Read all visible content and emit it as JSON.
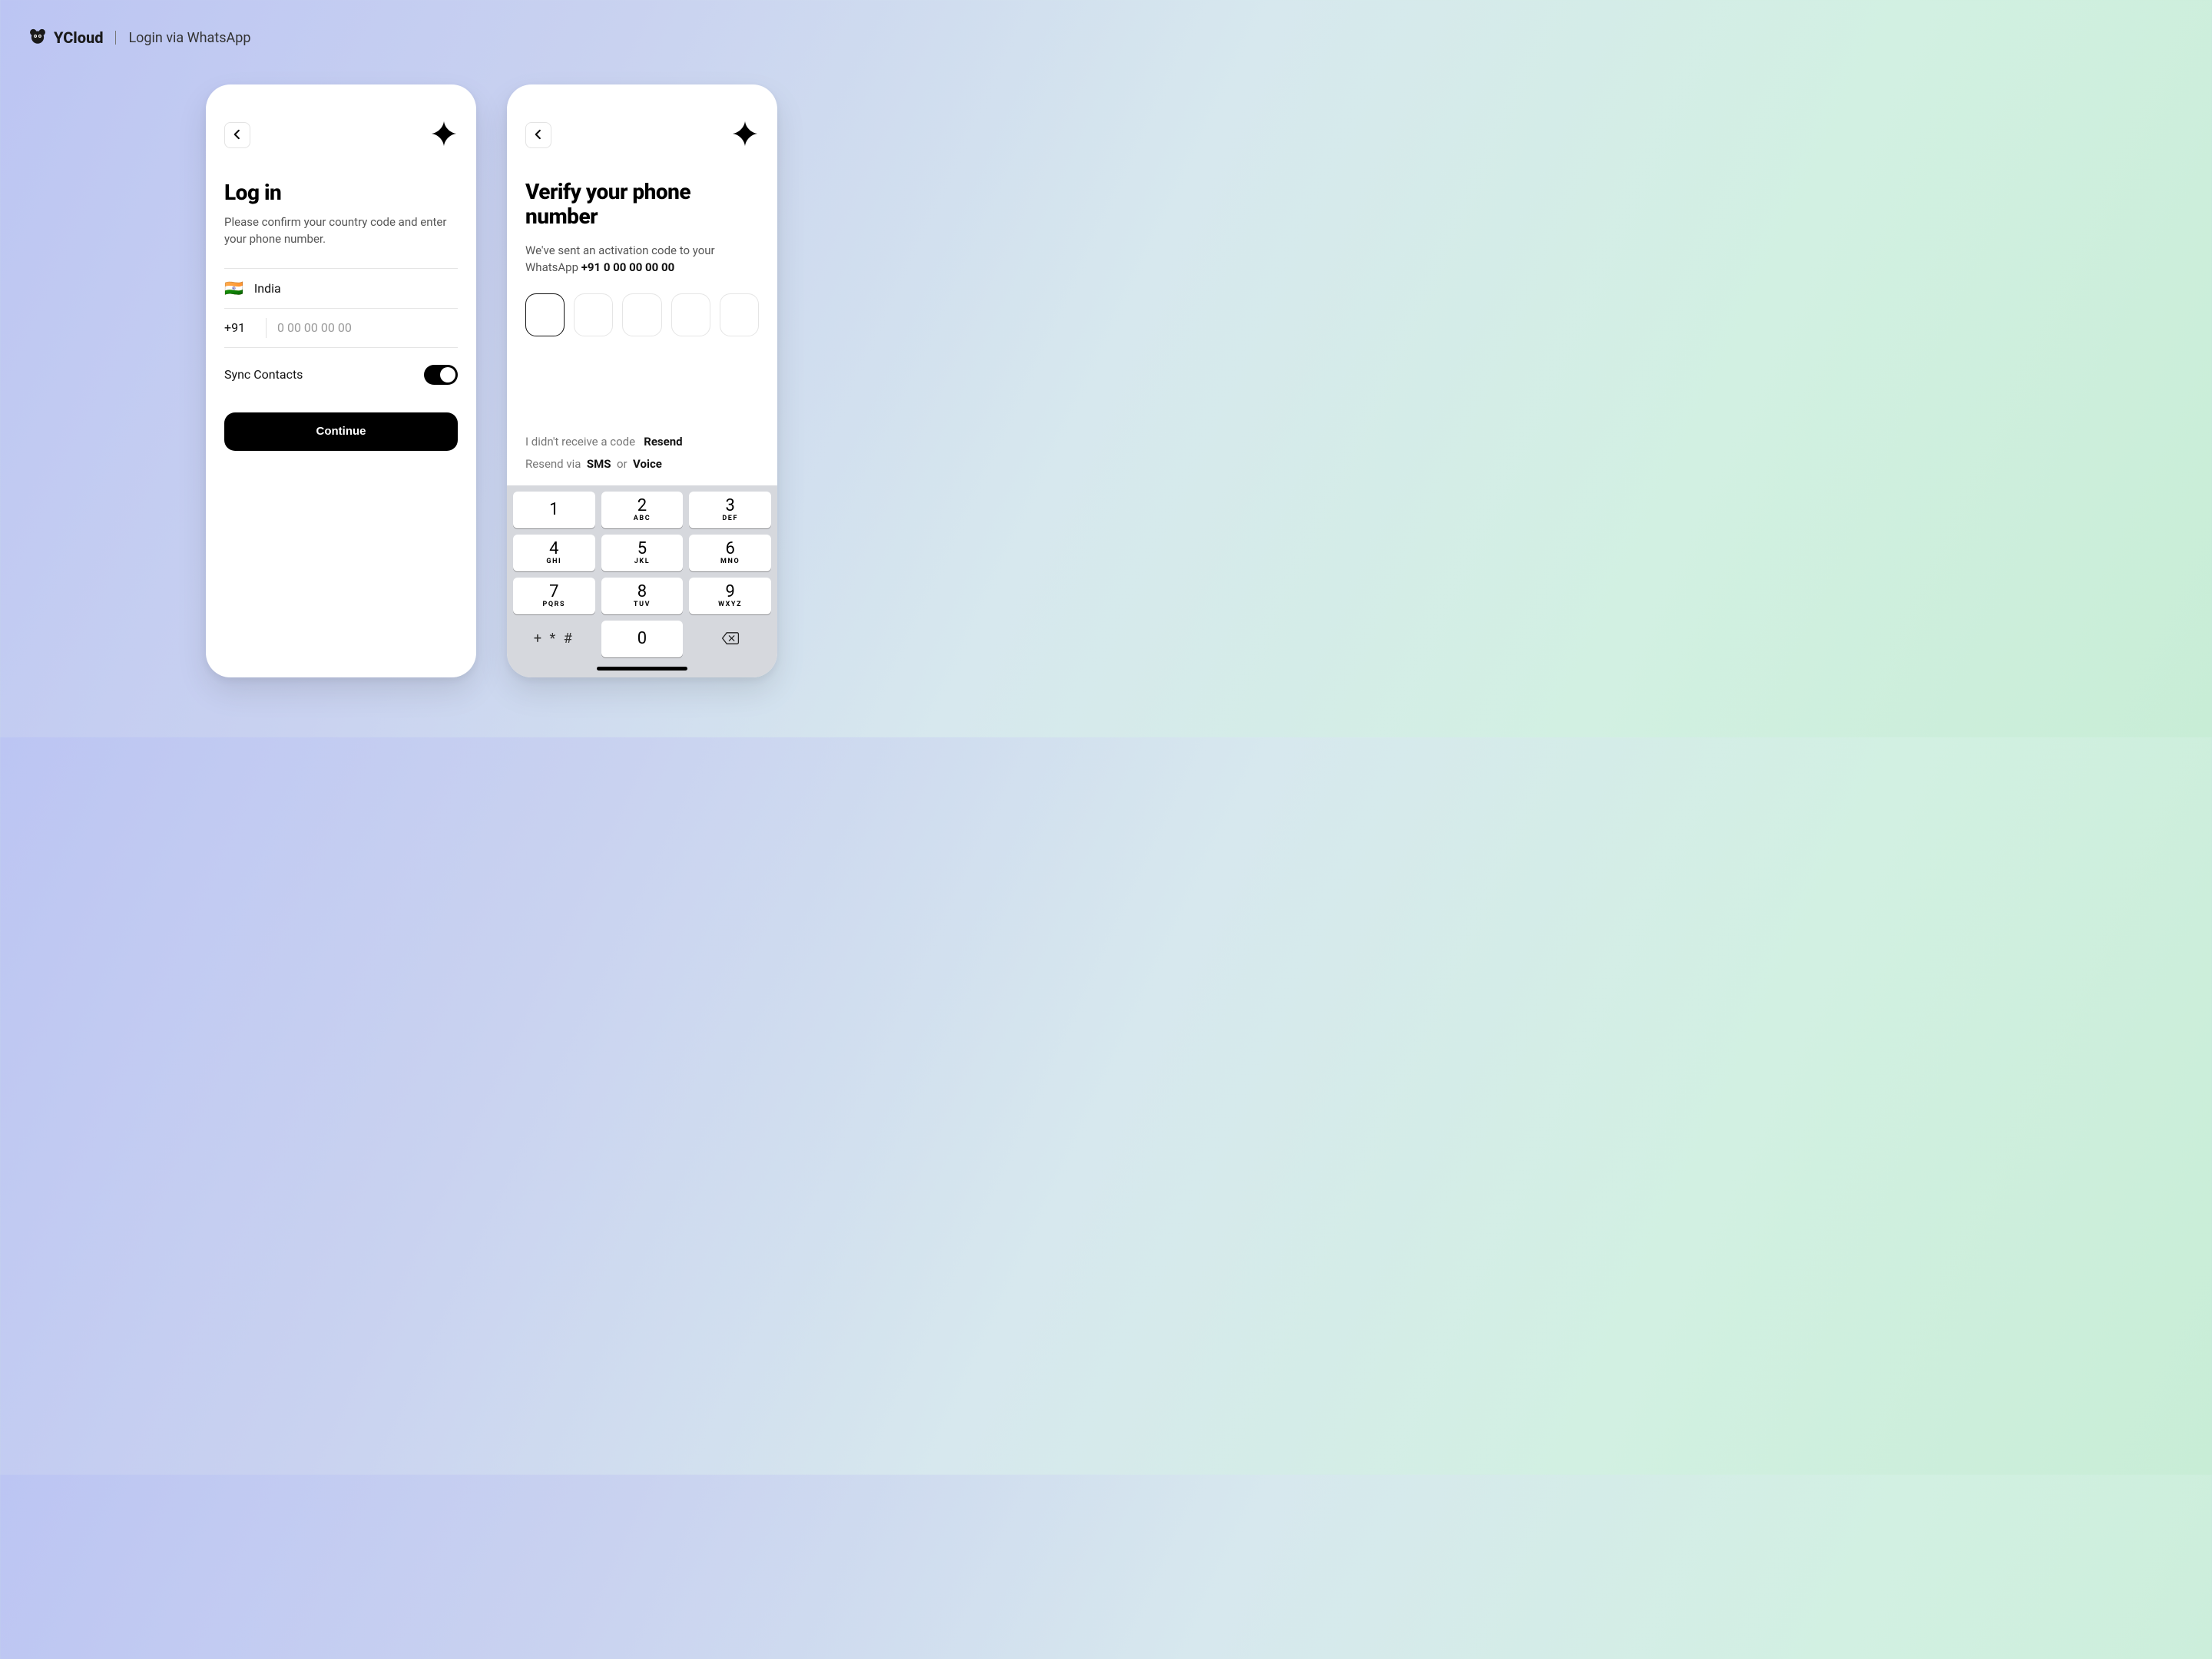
{
  "header": {
    "brand": "YCloud",
    "subtitle": "Login via WhatsApp"
  },
  "login": {
    "title": "Log in",
    "lead": "Please confirm your country code and enter your phone number.",
    "country_flag": "🇮🇳",
    "country_name": "India",
    "dial_code": "+91",
    "phone_placeholder": "0 00 00 00 00",
    "sync_label": "Sync Contacts",
    "sync_on": true,
    "continue_label": "Continue"
  },
  "verify": {
    "title": "Verify your phone number",
    "lead_prefix": "We've sent an activation code to your WhatsApp ",
    "lead_bold": "+91 0 00 00 00 00",
    "otp_count": 5,
    "noreceive": "I didn't receive a code",
    "resend": "Resend",
    "resend_via_prefix": "Resend via",
    "sms": "SMS",
    "or": "or",
    "voice": "Voice"
  },
  "keypad": {
    "keys": [
      {
        "d": "1",
        "l": ""
      },
      {
        "d": "2",
        "l": "ABC"
      },
      {
        "d": "3",
        "l": "DEF"
      },
      {
        "d": "4",
        "l": "GHI"
      },
      {
        "d": "5",
        "l": "JKL"
      },
      {
        "d": "6",
        "l": "MNO"
      },
      {
        "d": "7",
        "l": "PQRS"
      },
      {
        "d": "8",
        "l": "TUV"
      },
      {
        "d": "9",
        "l": "WXYZ"
      }
    ],
    "symbols": "+ * #",
    "zero": "0"
  }
}
